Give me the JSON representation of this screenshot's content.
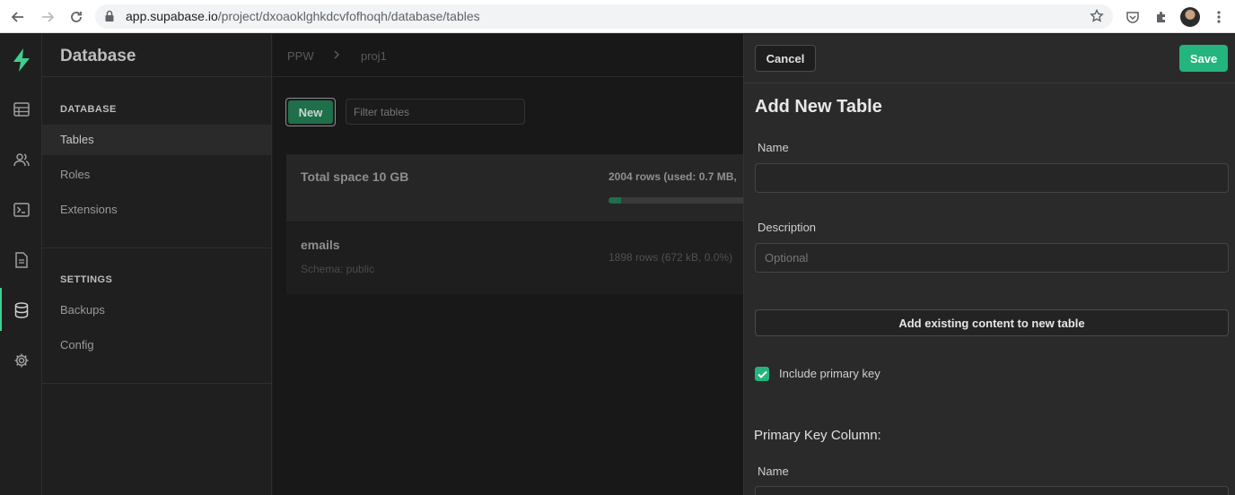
{
  "browser": {
    "url_host": "app.supabase.io",
    "url_path": "/project/dxoaoklghkdcvfofhoqh/database/tables"
  },
  "sidebar": {
    "title": "Database",
    "sections": [
      {
        "heading": "DATABASE",
        "items": [
          {
            "label": "Tables",
            "active": true
          },
          {
            "label": "Roles"
          },
          {
            "label": "Extensions"
          }
        ]
      },
      {
        "heading": "SETTINGS",
        "items": [
          {
            "label": "Backups"
          },
          {
            "label": "Config"
          }
        ]
      }
    ]
  },
  "main": {
    "breadcrumb": [
      "PPW",
      "proj1"
    ],
    "new_button": "New",
    "filter_placeholder": "Filter tables",
    "total_card": {
      "title": "Total space 10 GB",
      "stats": "2004 rows (used: 0.7 MB,",
      "progress": 0.07
    },
    "tables": [
      {
        "name": "emails",
        "schema": "Schema: public",
        "stats": "1898 rows (672 kB, 0.0%)"
      }
    ]
  },
  "panel": {
    "cancel_label": "Cancel",
    "save_label": "Save",
    "title": "Add New Table",
    "name_label": "Name",
    "name_value": "",
    "description_label": "Description",
    "description_placeholder": "Optional",
    "add_content_label": "Add existing content to new table",
    "include_pk_label": "Include primary key",
    "include_pk_checked": true,
    "pk_heading": "Primary Key Column:",
    "pk_name_label": "Name"
  },
  "colors": {
    "brand": "#3ecf8e",
    "save": "#24b47e",
    "new_button": "#1f6f4a"
  }
}
